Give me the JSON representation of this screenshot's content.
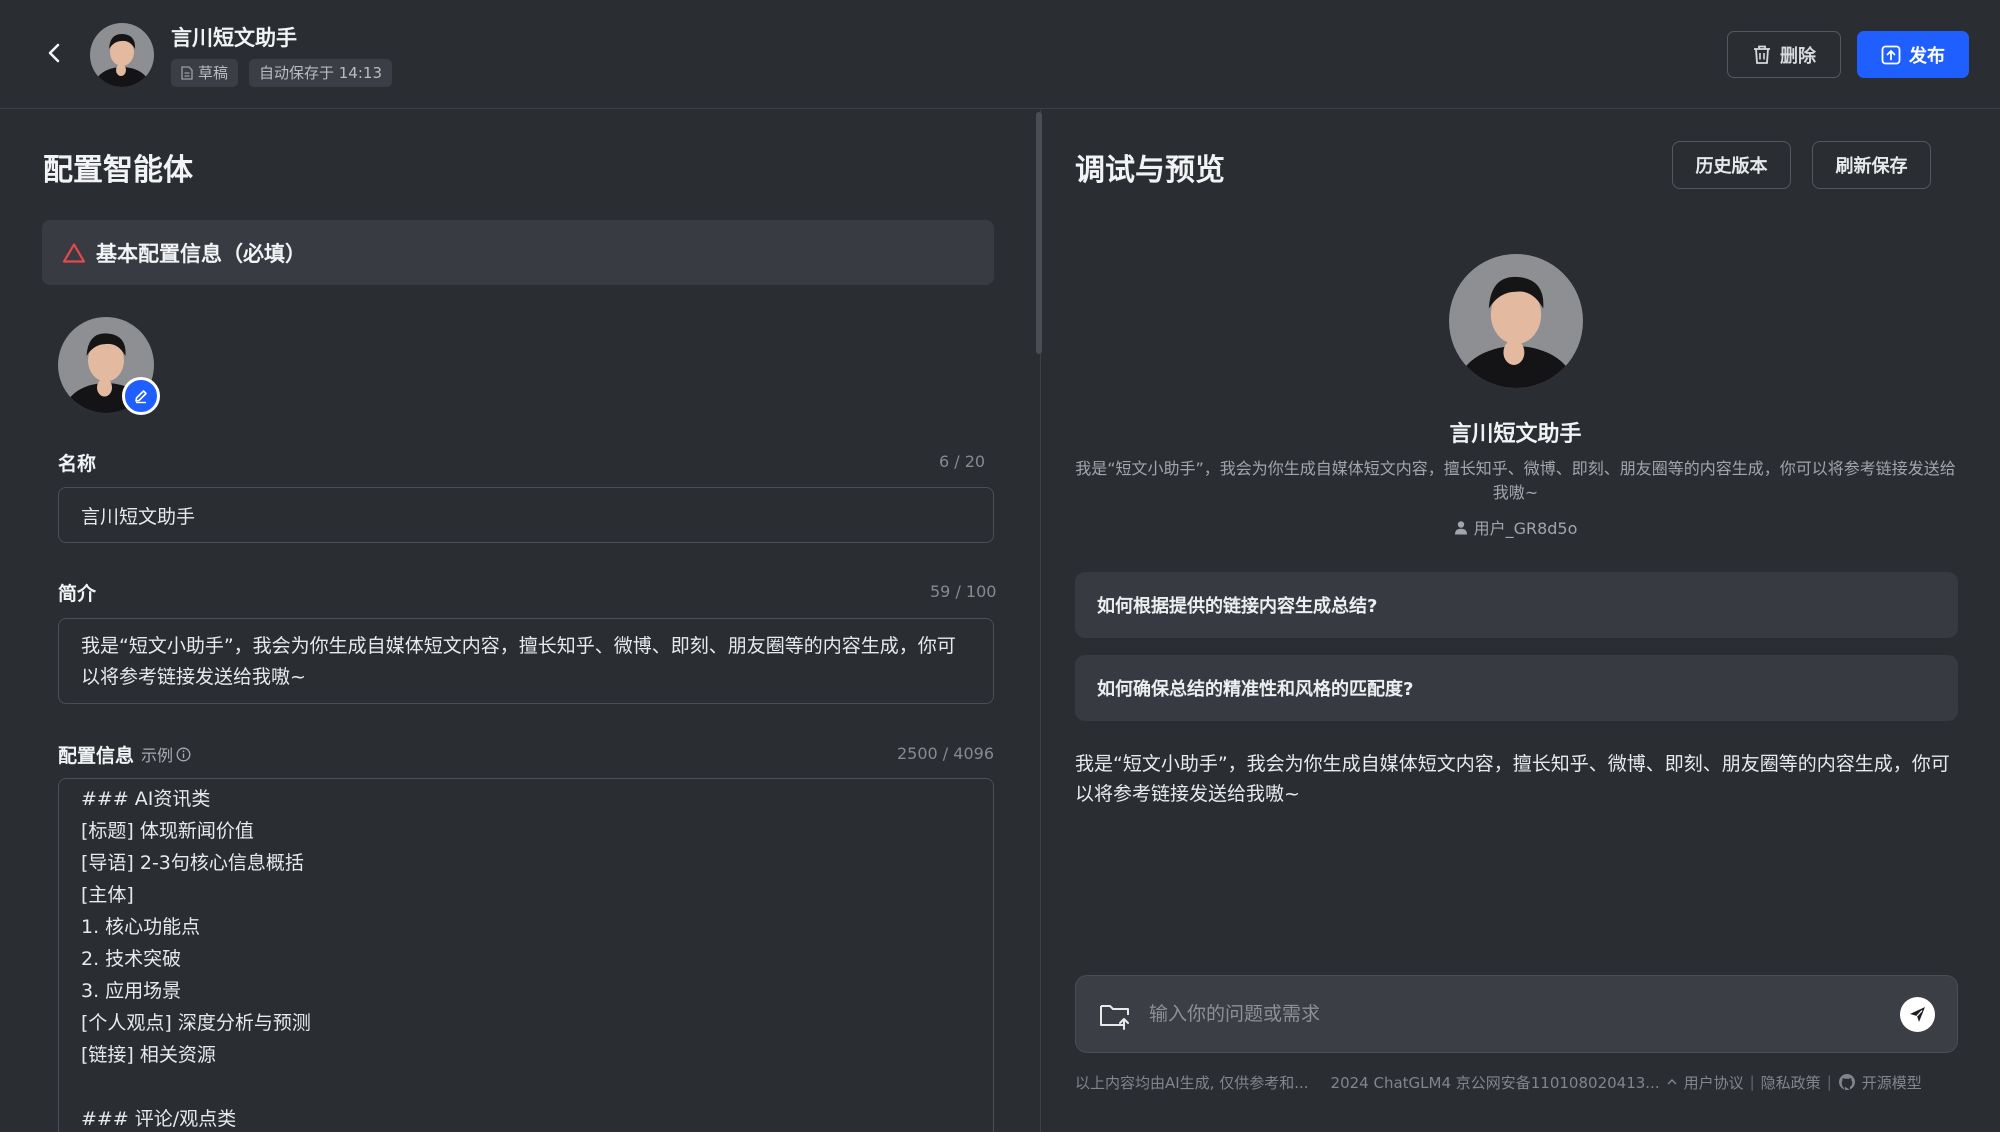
{
  "header": {
    "title": "言川短文助手",
    "draft_tag": "草稿",
    "autosave_tag": "自动保存于 14:13",
    "delete_label": "删除",
    "publish_label": "发布"
  },
  "config": {
    "heading": "配置智能体",
    "section_banner": "基本配置信息（必填）",
    "name_label": "名称",
    "name_count": "6 / 20",
    "name_value": "言川短文助手",
    "intro_label": "简介",
    "intro_count": "59 / 100",
    "intro_value": "我是“短文小助手”，我会为你生成自媒体短文内容，擅长知乎、微博、即刻、朋友圈等的内容生成，你可以将参考链接发送给我嗷~",
    "prompt_label": "配置信息",
    "example_label": "示例",
    "prompt_count": "2500 / 4096",
    "prompt_lines": [
      "### AI资讯类",
      "[标题] 体现新闻价值",
      "[导语] 2-3句核心信息概括",
      "[主体]",
      "1. 核心功能点",
      "2. 技术突破",
      "3. 应用场景",
      "[个人观点] 深度分析与预测",
      "[链接] 相关资源",
      "",
      "### 评论/观点类"
    ]
  },
  "preview": {
    "heading": "调试与预览",
    "history_label": "历史版本",
    "refresh_label": "刷新保存",
    "agent_name": "言川短文助手",
    "agent_desc": "我是“短文小助手”，我会为你生成自媒体短文内容，擅长知乎、微博、即刻、朋友圈等的内容生成，你可以将参考链接发送给我嗷~",
    "author": "用户_GR8d5o",
    "suggestions": [
      "如何根据提供的链接内容生成总结?",
      "如何确保总结的精准性和风格的匹配度?"
    ],
    "welcome_message": "我是“短文小助手”，我会为你生成自媒体短文内容，擅长知乎、微博、即刻、朋友圈等的内容生成，你可以将参考链接发送给我嗷~",
    "input_placeholder": "输入你的问题或需求"
  },
  "footer": {
    "disclaimer": "以上内容均由AI生成, 仅供参考和...",
    "icp": "2024 ChatGLM4 京公网安备110108020413...",
    "user_agreement": "用户协议",
    "privacy": "隐私政策",
    "open_source": "开源模型"
  },
  "colors": {
    "background": "#2a2d32",
    "accent": "#1f5eff",
    "warning": "#e5484d",
    "card": "#373a41"
  },
  "icons": {
    "back": "chevron-left-icon",
    "draft": "document-icon",
    "delete": "trash-icon",
    "publish": "upload-icon",
    "warning": "warning-triangle-icon",
    "edit": "pencil-icon",
    "info": "info-icon",
    "user": "user-icon",
    "folder": "folder-upload-icon",
    "send": "send-icon",
    "github": "github-icon"
  }
}
